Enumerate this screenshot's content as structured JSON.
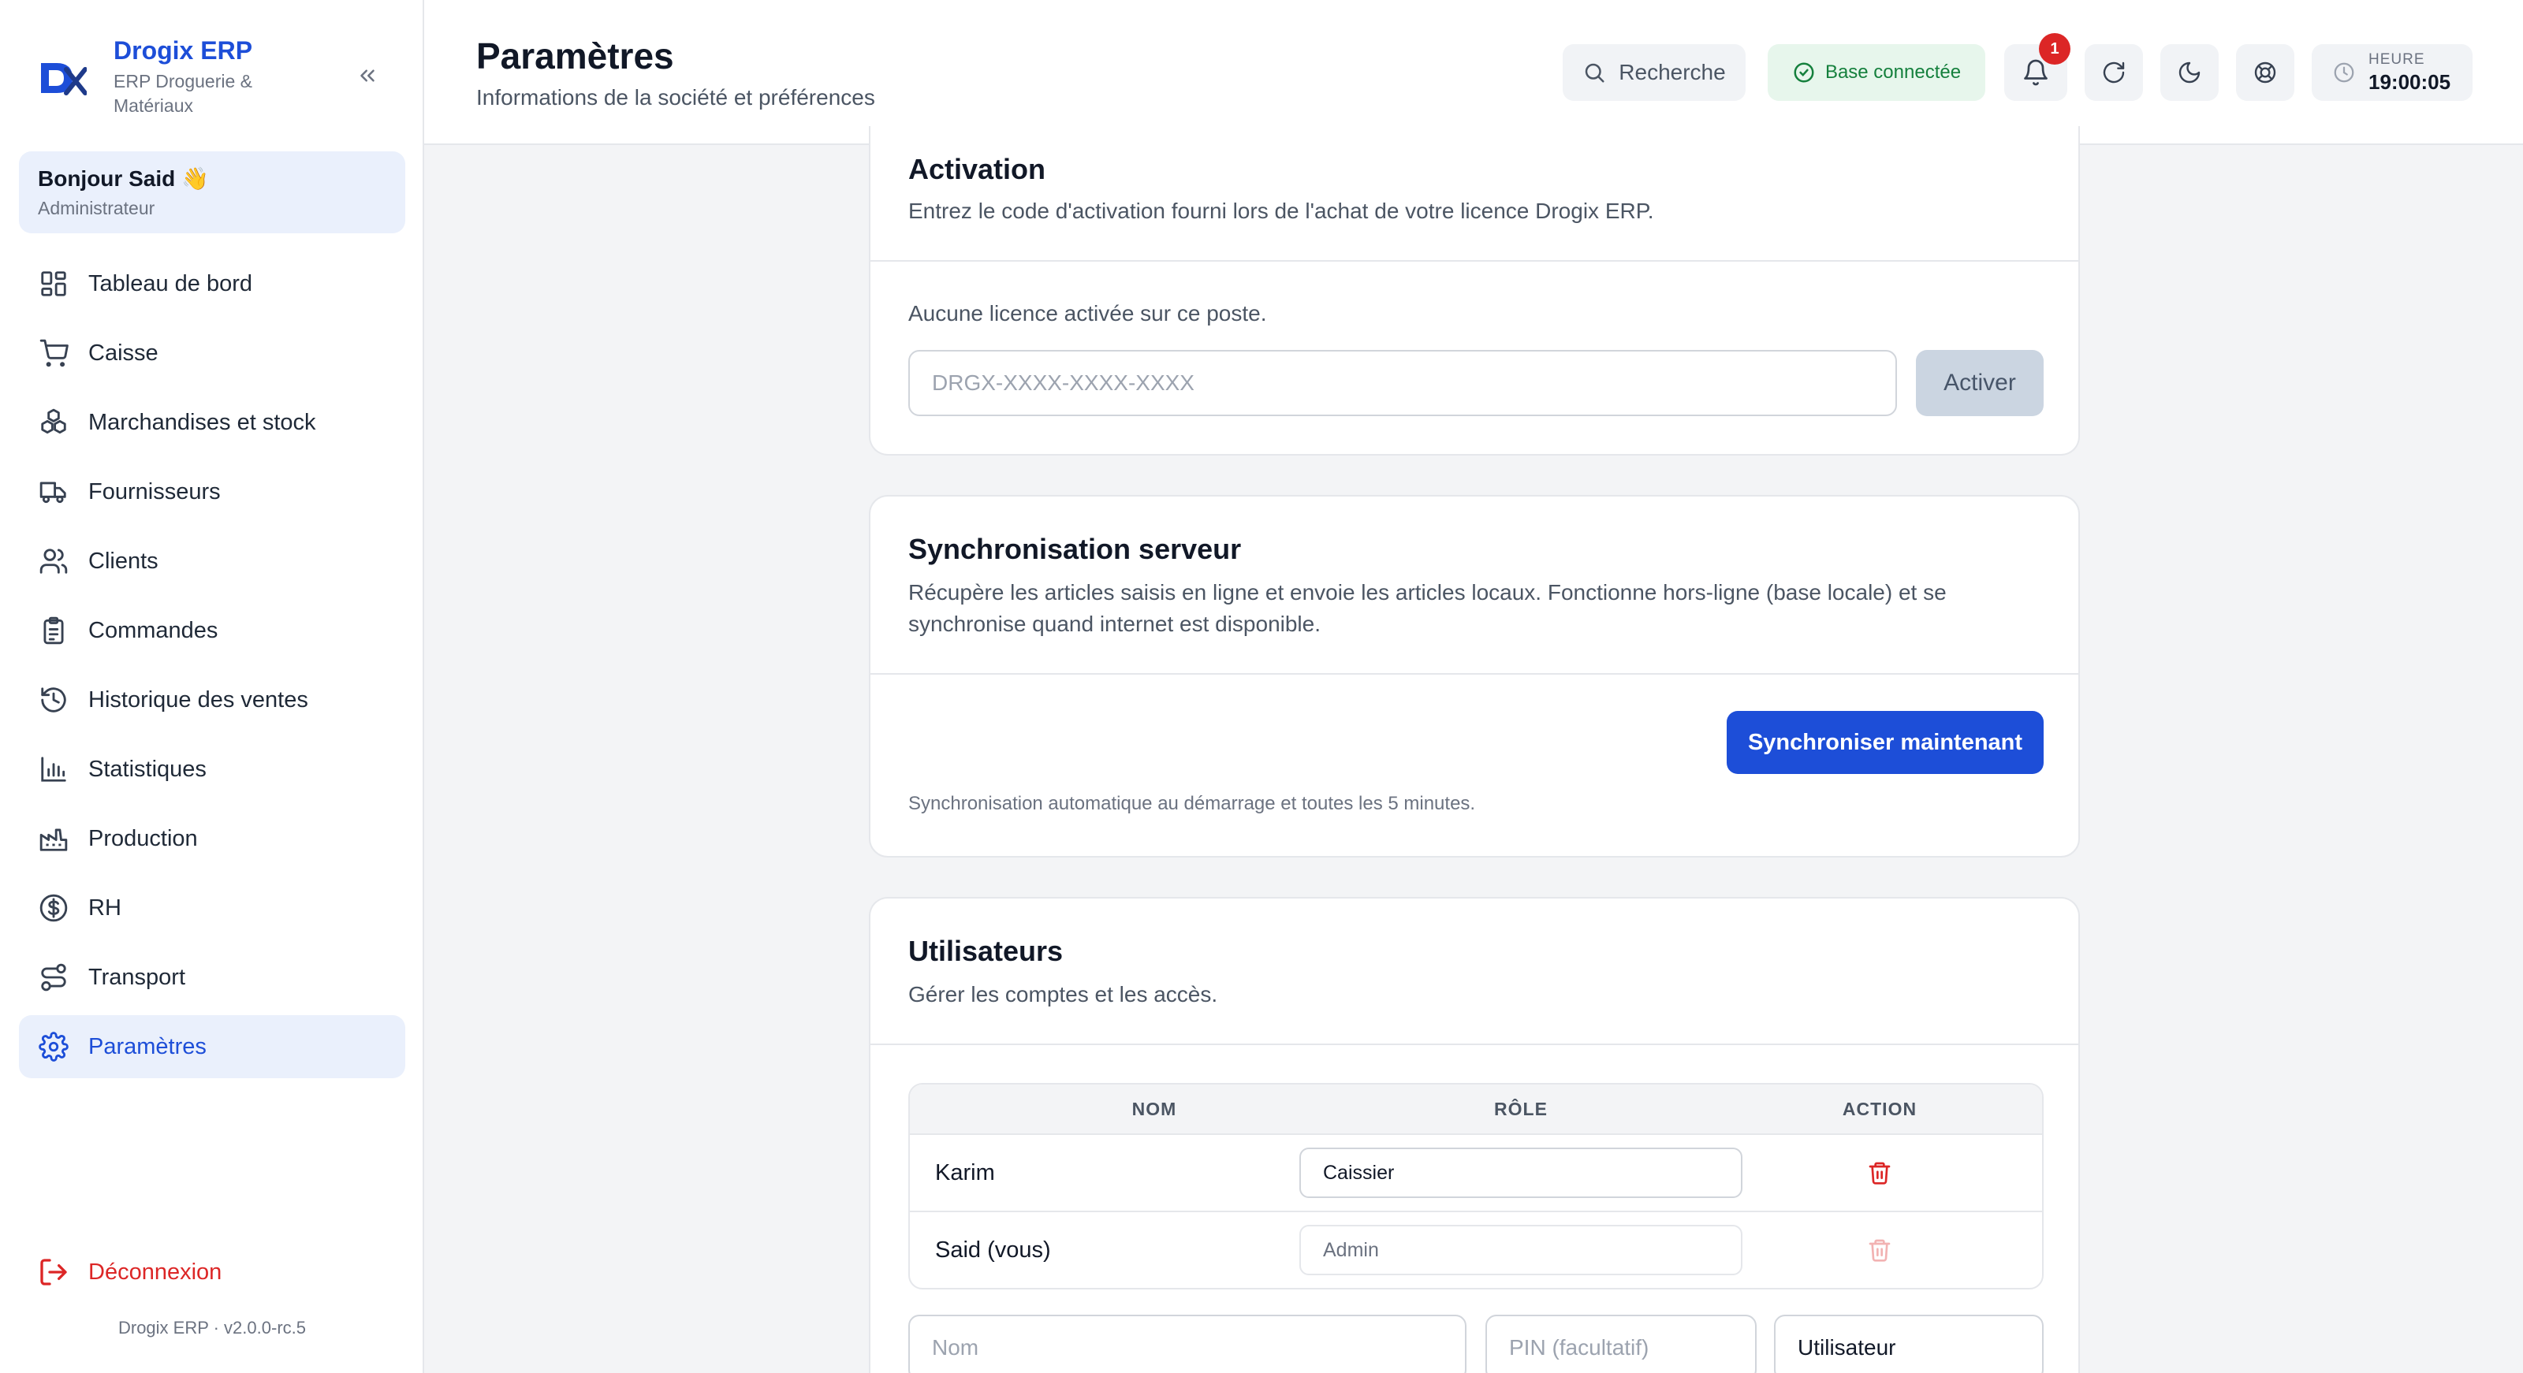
{
  "sidebar": {
    "brand": {
      "name": "Drogix ERP",
      "subtitle": "ERP Droguerie & Matériaux"
    },
    "greeting": {
      "name": "Bonjour Said 👋",
      "role": "Administrateur"
    },
    "items": [
      {
        "label": "Tableau de bord",
        "icon": "dashboard-icon"
      },
      {
        "label": "Caisse",
        "icon": "cart-icon"
      },
      {
        "label": "Marchandises et stock",
        "icon": "boxes-icon"
      },
      {
        "label": "Fournisseurs",
        "icon": "truck-icon"
      },
      {
        "label": "Clients",
        "icon": "users-icon"
      },
      {
        "label": "Commandes",
        "icon": "clipboard-icon"
      },
      {
        "label": "Historique des ventes",
        "icon": "history-icon"
      },
      {
        "label": "Statistiques",
        "icon": "bar-chart-icon"
      },
      {
        "label": "Production",
        "icon": "factory-icon"
      },
      {
        "label": "RH",
        "icon": "dollar-circle-icon"
      },
      {
        "label": "Transport",
        "icon": "route-icon"
      },
      {
        "label": "Paramètres",
        "icon": "gear-icon",
        "active": true
      }
    ],
    "logout": "Déconnexion",
    "version": "Drogix ERP · v2.0.0-rc.5"
  },
  "header": {
    "title": "Paramètres",
    "subtitle": "Informations de la société et préférences",
    "search_label": "Recherche",
    "db_status": "Base connectée",
    "notification_count": "1",
    "clock_label": "HEURE",
    "clock_time": "19:00:05"
  },
  "activation": {
    "title": "Activation",
    "description": "Entrez le code d'activation fourni lors de l'achat de votre licence Drogix ERP.",
    "status": "Aucune licence activée sur ce poste.",
    "placeholder": "DRGX-XXXX-XXXX-XXXX",
    "button": "Activer"
  },
  "sync": {
    "title": "Synchronisation serveur",
    "description": "Récupère les articles saisis en ligne et envoie les articles locaux. Fonctionne hors-ligne (base locale) et se synchronise quand internet est disponible.",
    "button": "Synchroniser maintenant",
    "note": "Synchronisation automatique au démarrage et toutes les 5 minutes."
  },
  "users": {
    "title": "Utilisateurs",
    "description": "Gérer les comptes et les accès.",
    "columns": {
      "name": "NOM",
      "role": "RÔLE",
      "action": "ACTION"
    },
    "rows": [
      {
        "name": "Karim",
        "role": "Caissier"
      },
      {
        "name": "Said (vous)",
        "role": "Admin"
      }
    ],
    "new_name_placeholder": "Nom",
    "new_pin_placeholder": "PIN (facultatif)",
    "new_role": "Utilisateur"
  },
  "colors": {
    "accent": "#1d4ed8",
    "danger": "#dc2626",
    "success": "#15803d",
    "active_bg": "#eaf0fc"
  }
}
